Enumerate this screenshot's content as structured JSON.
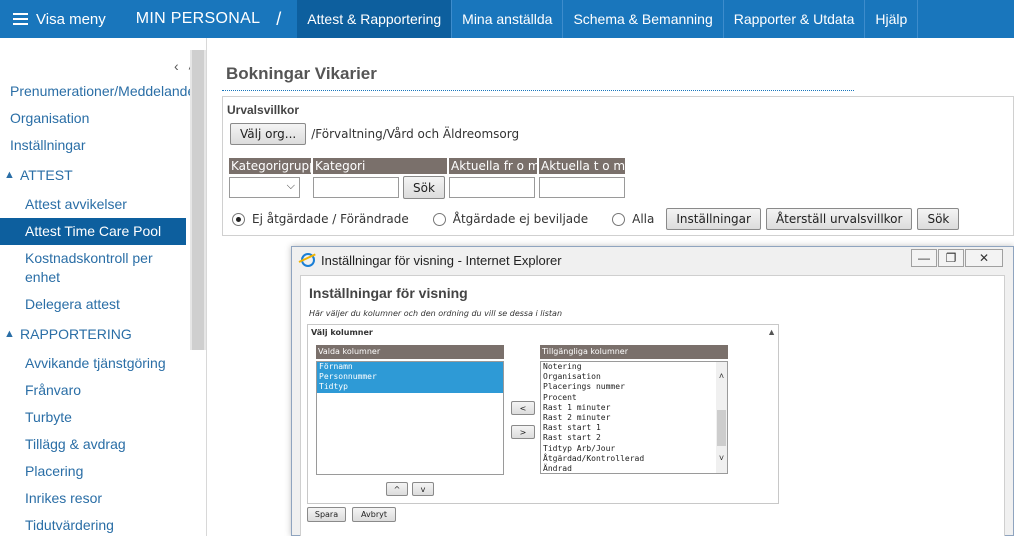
{
  "topnav": {
    "menu_label": "Visa meny",
    "brand": "MIN PERSONAL",
    "separator": "/",
    "items": [
      {
        "label": "Attest & Rapportering"
      },
      {
        "label": "Mina anställda"
      },
      {
        "label": "Schema & Bemanning"
      },
      {
        "label": "Rapporter & Utdata"
      },
      {
        "label": "Hjälp"
      }
    ]
  },
  "sidebar": {
    "collapse_glyphs": [
      "‹",
      "˄"
    ],
    "top_items": [
      "Prenumerationer/Meddelanden",
      "Organisation",
      "Inställningar"
    ],
    "attest": {
      "title": "ATTEST",
      "items": [
        "Attest avvikelser",
        "Attest Time Care Pool",
        "Kostnadskontroll per enhet",
        "Delegera attest"
      ]
    },
    "rapportering": {
      "title": "RAPPORTERING",
      "items": [
        "Avvikande tjänstgöring",
        "Frånvaro",
        "Turbyte",
        "Tillägg & avdrag",
        "Placering",
        "Inrikes resor",
        "Tidutvärdering"
      ]
    }
  },
  "main": {
    "title": "Bokningar Vikarier",
    "criteria_label": "Urvalsvillkor",
    "choose_org_button": "Välj org...",
    "org_path": "/Förvaltning/Vård och Äldreomsorg",
    "filters": {
      "headers": [
        "Kategorigrupp",
        "Kategori",
        "Aktuella fr o m",
        "Aktuella t o m"
      ],
      "search_button": "Sök"
    },
    "radios": [
      {
        "label": "Ej åtgärdade / Förändrade",
        "checked": true
      },
      {
        "label": "Åtgärdade ej beviljade",
        "checked": false
      },
      {
        "label": "Alla",
        "checked": false
      }
    ],
    "buttons": {
      "settings": "Inställningar",
      "reset": "Återställ urvalsvillkor",
      "search": "Sök"
    }
  },
  "dialog": {
    "window_title": "Inställningar för visning - Internet Explorer",
    "heading": "Inställningar för visning",
    "hint": "Här väljer du kolumner och den ordning du vill se dessa i listan",
    "columns_title": "Välj kolumner",
    "selected_header": "Valda kolumner",
    "selected_columns": [
      "Förnamn",
      "Personnummer",
      "Tidtyp"
    ],
    "available_header": "Tillgängliga kolumner",
    "available_columns": [
      "Notering",
      "Organisation",
      "Placerings nummer",
      "Procent",
      "Rast 1 minuter",
      "Rast 2 minuter",
      "Rast start 1",
      "Rast start 2",
      "Tidtyp Arb/Jour",
      "Åtgärdad/Kontrollerad",
      "Ändrad"
    ],
    "move_left": "<",
    "move_right": ">",
    "move_up": "^",
    "move_down": "v",
    "save_button": "Spara",
    "cancel_button": "Avbryt"
  },
  "colors": {
    "nav_bg": "#1976bc",
    "nav_active": "#0d5f9e",
    "link": "#2a6ea6",
    "table_header": "#7a706b",
    "selection": "#2e9ad6"
  }
}
